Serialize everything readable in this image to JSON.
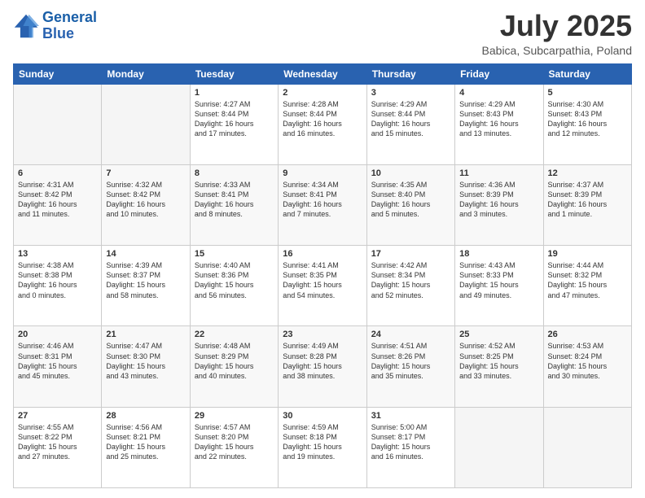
{
  "header": {
    "logo_line1": "General",
    "logo_line2": "Blue",
    "month_year": "July 2025",
    "location": "Babica, Subcarpathia, Poland"
  },
  "weekdays": [
    "Sunday",
    "Monday",
    "Tuesday",
    "Wednesday",
    "Thursday",
    "Friday",
    "Saturday"
  ],
  "weeks": [
    [
      {
        "day": "",
        "info": ""
      },
      {
        "day": "",
        "info": ""
      },
      {
        "day": "1",
        "info": "Sunrise: 4:27 AM\nSunset: 8:44 PM\nDaylight: 16 hours\nand 17 minutes."
      },
      {
        "day": "2",
        "info": "Sunrise: 4:28 AM\nSunset: 8:44 PM\nDaylight: 16 hours\nand 16 minutes."
      },
      {
        "day": "3",
        "info": "Sunrise: 4:29 AM\nSunset: 8:44 PM\nDaylight: 16 hours\nand 15 minutes."
      },
      {
        "day": "4",
        "info": "Sunrise: 4:29 AM\nSunset: 8:43 PM\nDaylight: 16 hours\nand 13 minutes."
      },
      {
        "day": "5",
        "info": "Sunrise: 4:30 AM\nSunset: 8:43 PM\nDaylight: 16 hours\nand 12 minutes."
      }
    ],
    [
      {
        "day": "6",
        "info": "Sunrise: 4:31 AM\nSunset: 8:42 PM\nDaylight: 16 hours\nand 11 minutes."
      },
      {
        "day": "7",
        "info": "Sunrise: 4:32 AM\nSunset: 8:42 PM\nDaylight: 16 hours\nand 10 minutes."
      },
      {
        "day": "8",
        "info": "Sunrise: 4:33 AM\nSunset: 8:41 PM\nDaylight: 16 hours\nand 8 minutes."
      },
      {
        "day": "9",
        "info": "Sunrise: 4:34 AM\nSunset: 8:41 PM\nDaylight: 16 hours\nand 7 minutes."
      },
      {
        "day": "10",
        "info": "Sunrise: 4:35 AM\nSunset: 8:40 PM\nDaylight: 16 hours\nand 5 minutes."
      },
      {
        "day": "11",
        "info": "Sunrise: 4:36 AM\nSunset: 8:39 PM\nDaylight: 16 hours\nand 3 minutes."
      },
      {
        "day": "12",
        "info": "Sunrise: 4:37 AM\nSunset: 8:39 PM\nDaylight: 16 hours\nand 1 minute."
      }
    ],
    [
      {
        "day": "13",
        "info": "Sunrise: 4:38 AM\nSunset: 8:38 PM\nDaylight: 16 hours\nand 0 minutes."
      },
      {
        "day": "14",
        "info": "Sunrise: 4:39 AM\nSunset: 8:37 PM\nDaylight: 15 hours\nand 58 minutes."
      },
      {
        "day": "15",
        "info": "Sunrise: 4:40 AM\nSunset: 8:36 PM\nDaylight: 15 hours\nand 56 minutes."
      },
      {
        "day": "16",
        "info": "Sunrise: 4:41 AM\nSunset: 8:35 PM\nDaylight: 15 hours\nand 54 minutes."
      },
      {
        "day": "17",
        "info": "Sunrise: 4:42 AM\nSunset: 8:34 PM\nDaylight: 15 hours\nand 52 minutes."
      },
      {
        "day": "18",
        "info": "Sunrise: 4:43 AM\nSunset: 8:33 PM\nDaylight: 15 hours\nand 49 minutes."
      },
      {
        "day": "19",
        "info": "Sunrise: 4:44 AM\nSunset: 8:32 PM\nDaylight: 15 hours\nand 47 minutes."
      }
    ],
    [
      {
        "day": "20",
        "info": "Sunrise: 4:46 AM\nSunset: 8:31 PM\nDaylight: 15 hours\nand 45 minutes."
      },
      {
        "day": "21",
        "info": "Sunrise: 4:47 AM\nSunset: 8:30 PM\nDaylight: 15 hours\nand 43 minutes."
      },
      {
        "day": "22",
        "info": "Sunrise: 4:48 AM\nSunset: 8:29 PM\nDaylight: 15 hours\nand 40 minutes."
      },
      {
        "day": "23",
        "info": "Sunrise: 4:49 AM\nSunset: 8:28 PM\nDaylight: 15 hours\nand 38 minutes."
      },
      {
        "day": "24",
        "info": "Sunrise: 4:51 AM\nSunset: 8:26 PM\nDaylight: 15 hours\nand 35 minutes."
      },
      {
        "day": "25",
        "info": "Sunrise: 4:52 AM\nSunset: 8:25 PM\nDaylight: 15 hours\nand 33 minutes."
      },
      {
        "day": "26",
        "info": "Sunrise: 4:53 AM\nSunset: 8:24 PM\nDaylight: 15 hours\nand 30 minutes."
      }
    ],
    [
      {
        "day": "27",
        "info": "Sunrise: 4:55 AM\nSunset: 8:22 PM\nDaylight: 15 hours\nand 27 minutes."
      },
      {
        "day": "28",
        "info": "Sunrise: 4:56 AM\nSunset: 8:21 PM\nDaylight: 15 hours\nand 25 minutes."
      },
      {
        "day": "29",
        "info": "Sunrise: 4:57 AM\nSunset: 8:20 PM\nDaylight: 15 hours\nand 22 minutes."
      },
      {
        "day": "30",
        "info": "Sunrise: 4:59 AM\nSunset: 8:18 PM\nDaylight: 15 hours\nand 19 minutes."
      },
      {
        "day": "31",
        "info": "Sunrise: 5:00 AM\nSunset: 8:17 PM\nDaylight: 15 hours\nand 16 minutes."
      },
      {
        "day": "",
        "info": ""
      },
      {
        "day": "",
        "info": ""
      }
    ]
  ]
}
